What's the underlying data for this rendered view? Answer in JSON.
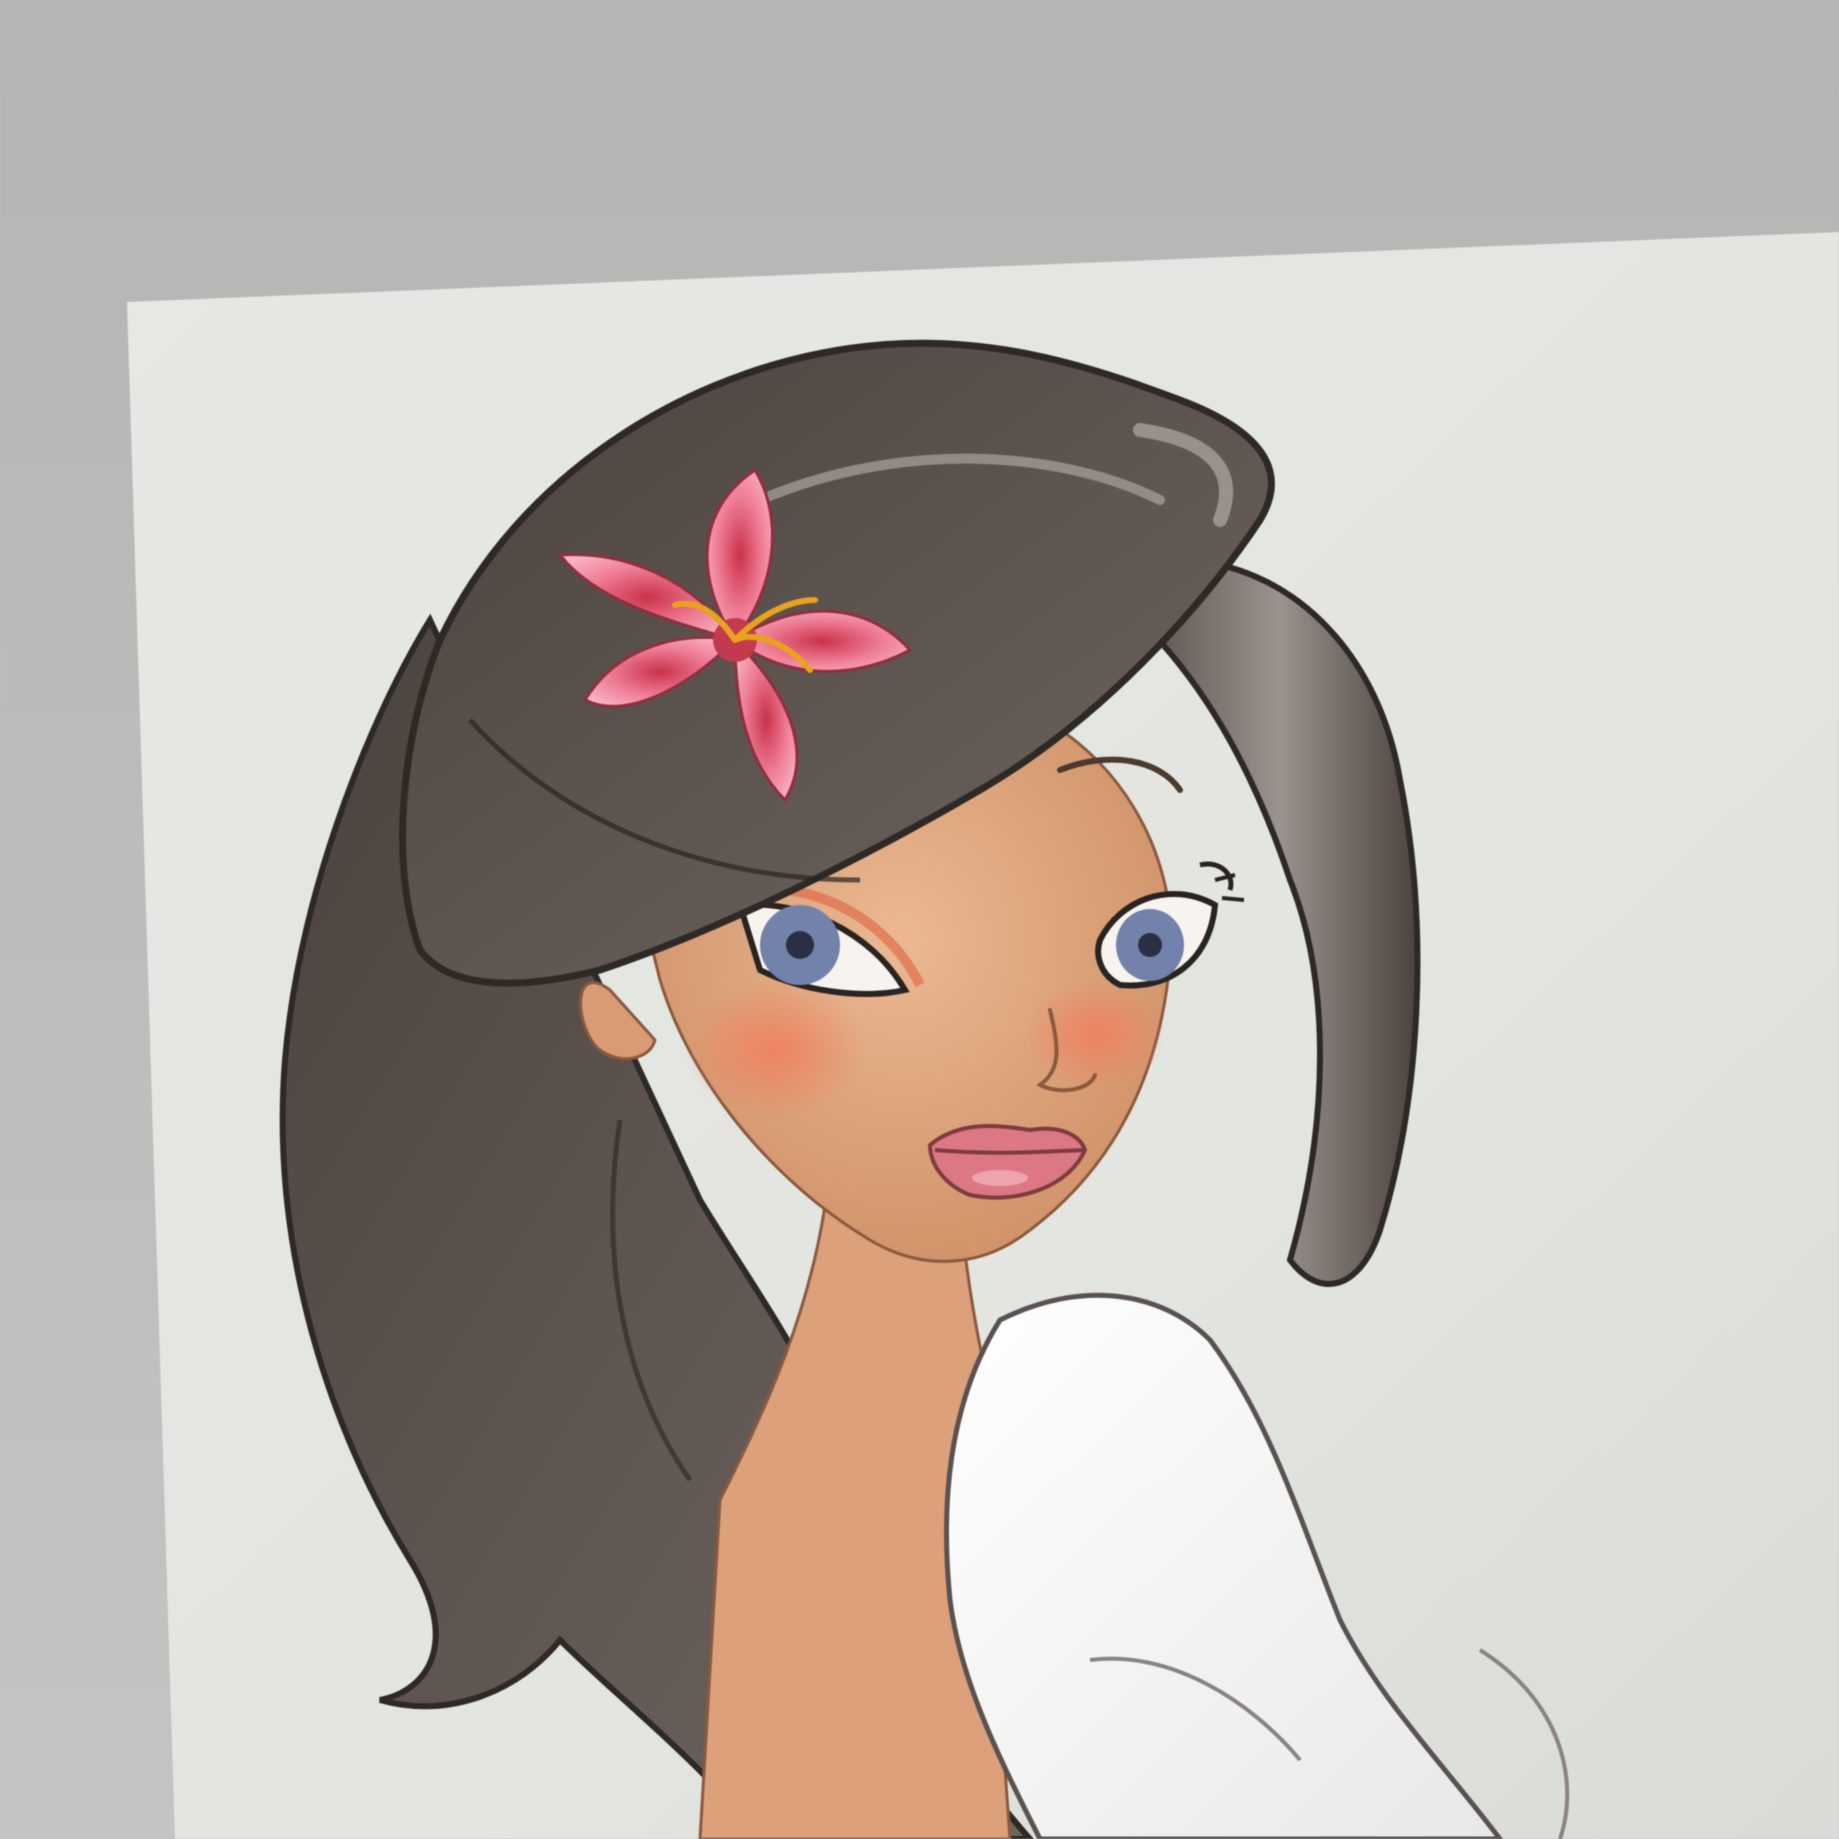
{
  "photo": {
    "subject": "cartoon-girl-illustration",
    "colors": {
      "wall": "#bdbdbc",
      "screen": "#e4e6e2",
      "hair": "#5a514b",
      "hair_dark": "#2f2925",
      "hair_light": "#8d847e",
      "skin": "#e3ac83",
      "skin_shadow": "#c98c63",
      "blush": "#f08a70",
      "lips": "#d9747c",
      "flower": "#ec7d95",
      "flower_center": "#c83a50",
      "iris": "#6f7fa8",
      "shirt": "#f4f4f2"
    }
  }
}
